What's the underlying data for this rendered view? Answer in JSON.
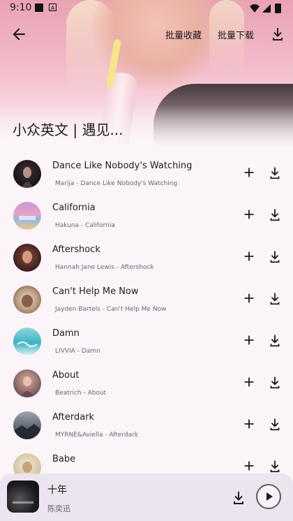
{
  "status": {
    "time": "9:10",
    "badge": "A"
  },
  "toolbar": {
    "fav_label": "批量收藏",
    "download_label": "批量下载"
  },
  "playlist": {
    "title": "小众英文 | 遇见..."
  },
  "songs": [
    {
      "title": "Dance Like Nobody's Watching",
      "subtitle": "Marija - Dance Like Nobody's Watching"
    },
    {
      "title": "California",
      "subtitle": "Hakuna - California"
    },
    {
      "title": "Aftershock",
      "subtitle": "Hannah Jane Lewis - Aftershock"
    },
    {
      "title": "Can't Help Me Now",
      "subtitle": "Jayden Bartels - Can't Help Me Now"
    },
    {
      "title": "Damn",
      "subtitle": "LIVVIA - Damn"
    },
    {
      "title": "About",
      "subtitle": "Beatrich - About"
    },
    {
      "title": "Afterdark",
      "subtitle": "MYRNE&Aviella - Afterdark"
    },
    {
      "title": "Babe",
      "subtitle": ""
    }
  ],
  "player": {
    "title": "十年",
    "artist": "陈奕迅"
  },
  "colors": {
    "header_pink": "#f1b8c7",
    "background": "#fbf5fa",
    "player_bg": "#ece4ee"
  },
  "icons": {
    "back": "arrow-left",
    "add": "plus",
    "download": "download-tray",
    "play": "play-triangle"
  }
}
